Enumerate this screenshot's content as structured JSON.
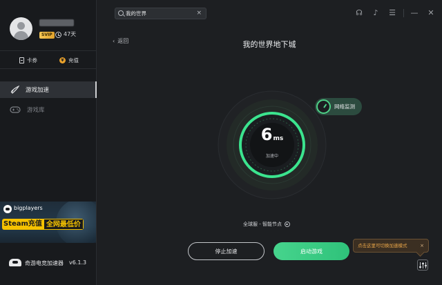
{
  "sidebar": {
    "vip_badge": "SVIP",
    "days": "47天",
    "card_label": "卡券",
    "recharge_label": "充值",
    "coin_symbol": "¥",
    "nav": [
      {
        "label": "游戏加速",
        "icon": "rocket-icon",
        "active": true
      },
      {
        "label": "游戏库",
        "icon": "gamepad-icon",
        "active": false
      }
    ],
    "banner": {
      "brand": "bigplayers",
      "steam": "Steam充值",
      "promo": "全网最低价"
    },
    "app_name": "奇游电竞加速器",
    "version": "v6.1.3"
  },
  "topbar": {
    "search_value": "我的世界",
    "clear": "×",
    "icons": [
      "headset-icon",
      "bell-icon",
      "menu-icon",
      "minimize-icon",
      "close-icon"
    ],
    "icon_glyphs": [
      "☊",
      "♪",
      "☰",
      "—",
      "✕"
    ]
  },
  "main": {
    "back_label": "返回",
    "back_arrow": "‹",
    "game_title": "我的世界地下城",
    "latency_value": "6",
    "latency_unit": "ms",
    "status": "加速中",
    "network_monitor": "网络监测",
    "node": "全球服 - 智能节点",
    "stop_label": "停止加速",
    "start_label": "启动游戏",
    "tooltip": "点击这里可切换加速模式",
    "tooltip_close": "×"
  },
  "colors": {
    "accent": "#46d48d",
    "background": "#1d1f22",
    "sidebar": "#181a1d",
    "warning": "#e8a548"
  }
}
